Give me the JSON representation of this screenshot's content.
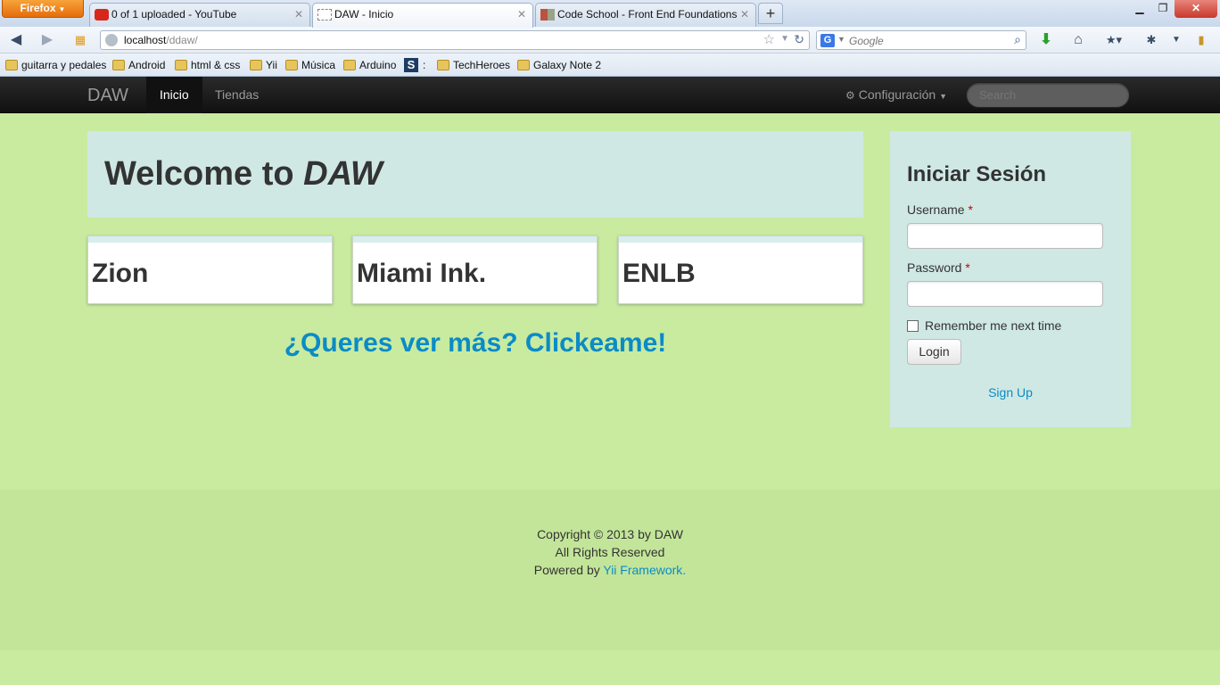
{
  "browser": {
    "app_button": "Firefox",
    "tabs": [
      {
        "title": "0 of 1 uploaded - YouTube",
        "favicon": "youtube-icon"
      },
      {
        "title": "DAW - Inicio",
        "favicon": "blank-page-icon"
      },
      {
        "title": "Code School - Front End Foundations",
        "favicon": "codeschool-icon"
      }
    ],
    "new_tab": "+",
    "url_host": "localhost",
    "url_path": "/ddaw/",
    "search_engine": "G",
    "search_placeholder": "Google",
    "bookmarks": [
      {
        "label": "guitarra y pedales",
        "icon": "folder-icon"
      },
      {
        "label": "Android",
        "icon": "folder-icon"
      },
      {
        "label": "html & css",
        "icon": "folder-icon"
      },
      {
        "label": "Yii",
        "icon": "folder-icon"
      },
      {
        "label": "Música",
        "icon": "folder-icon"
      },
      {
        "label": "Arduino",
        "icon": "folder-icon"
      },
      {
        "label": ":",
        "icon": "s-logo-icon"
      },
      {
        "label": "TechHeroes",
        "icon": "folder-icon"
      },
      {
        "label": "Galaxy Note 2",
        "icon": "folder-icon"
      }
    ]
  },
  "site": {
    "brand": "DAW",
    "nav": [
      {
        "label": "Inicio",
        "active": true
      },
      {
        "label": "Tiendas",
        "active": false
      }
    ],
    "config_label": "Configuración",
    "search_placeholder": "Search"
  },
  "hero": {
    "title_prefix": "Welcome to ",
    "title_em": "DAW"
  },
  "stores": [
    {
      "name": "Zion"
    },
    {
      "name": "Miami Ink."
    },
    {
      "name": "ENLB"
    }
  ],
  "more_link": "¿Queres ver más? Clickeame!",
  "login": {
    "title": "Iniciar Sesión",
    "username_label": "Username",
    "password_label": "Password",
    "required_mark": "*",
    "remember_label": "Remember me next time",
    "login_button": "Login",
    "signup_link": "Sign Up"
  },
  "footer": {
    "copyright": "Copyright © 2013 by DAW",
    "rights": "All Rights Reserved",
    "powered_prefix": "Powered by ",
    "powered_link": "Yii Framework",
    "powered_suffix": "."
  },
  "colors": {
    "page_bg": "#c8eba0",
    "panel_bg": "#cfe8e4",
    "link": "#0b8bc7",
    "navbar": "#1b1b1b"
  }
}
